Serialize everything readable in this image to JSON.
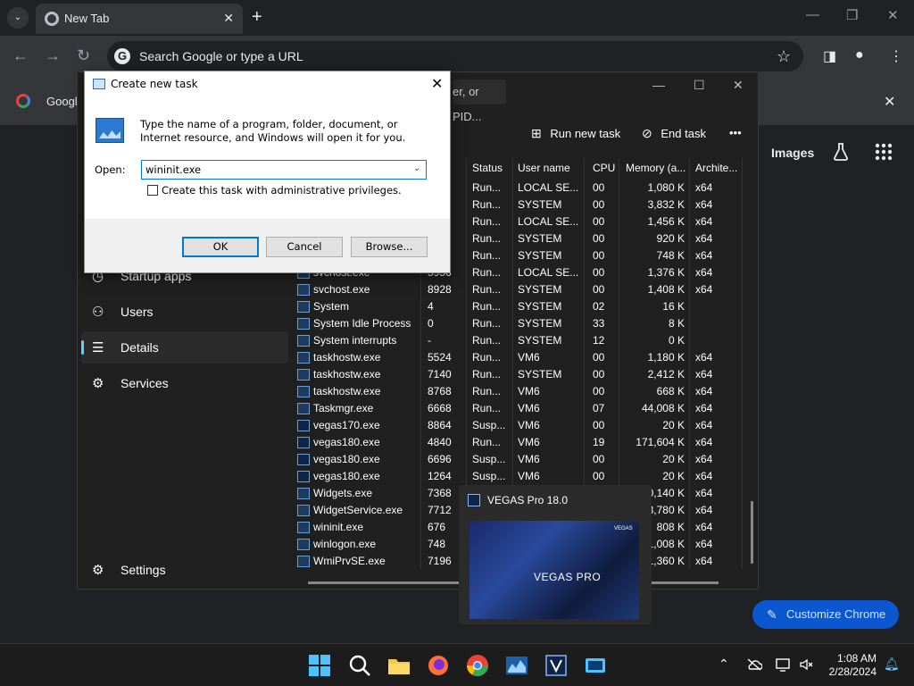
{
  "chrome": {
    "tab_title": "New Tab",
    "omnibox_placeholder": "Search Google or type a URL",
    "bookmark_label": "Googl",
    "images_link": "Images",
    "customize_label": "Customize Chrome"
  },
  "taskmgr": {
    "search_placeholder": "er, or PID...",
    "run_new_task": "Run new task",
    "end_task": "End task",
    "more": "•••",
    "sidebar": [
      {
        "label": "Startup apps",
        "icon": "startup-icon"
      },
      {
        "label": "Users",
        "icon": "users-icon"
      },
      {
        "label": "Details",
        "icon": "details-icon",
        "active": true
      },
      {
        "label": "Services",
        "icon": "services-icon"
      }
    ],
    "settings_label": "Settings",
    "columns": {
      "status": "Status",
      "user": "User name",
      "cpu": "CPU",
      "memory": "Memory (a...",
      "arch": "Archite..."
    },
    "rows": [
      {
        "name": "",
        "pid": "",
        "status": "Run...",
        "user": "LOCAL SE...",
        "cpu": "00",
        "mem": "1,080 K",
        "arch": "x64"
      },
      {
        "name": "",
        "pid": "",
        "status": "Run...",
        "user": "SYSTEM",
        "cpu": "00",
        "mem": "3,832 K",
        "arch": "x64"
      },
      {
        "name": "",
        "pid": "",
        "status": "Run...",
        "user": "LOCAL SE...",
        "cpu": "00",
        "mem": "1,456 K",
        "arch": "x64"
      },
      {
        "name": "",
        "pid": "",
        "status": "Run...",
        "user": "SYSTEM",
        "cpu": "00",
        "mem": "920 K",
        "arch": "x64"
      },
      {
        "name": "",
        "pid": "",
        "status": "Run...",
        "user": "SYSTEM",
        "cpu": "00",
        "mem": "748 K",
        "arch": "x64"
      },
      {
        "name": "svchost.exe",
        "pid": "5956",
        "status": "Run...",
        "user": "LOCAL SE...",
        "cpu": "00",
        "mem": "1,376 K",
        "arch": "x64"
      },
      {
        "name": "svchost.exe",
        "pid": "8928",
        "status": "Run...",
        "user": "SYSTEM",
        "cpu": "00",
        "mem": "1,408 K",
        "arch": "x64"
      },
      {
        "name": "System",
        "pid": "4",
        "status": "Run...",
        "user": "SYSTEM",
        "cpu": "02",
        "mem": "16 K",
        "arch": ""
      },
      {
        "name": "System Idle Process",
        "pid": "0",
        "status": "Run...",
        "user": "SYSTEM",
        "cpu": "33",
        "mem": "8 K",
        "arch": ""
      },
      {
        "name": "System interrupts",
        "pid": "-",
        "status": "Run...",
        "user": "SYSTEM",
        "cpu": "12",
        "mem": "0 K",
        "arch": ""
      },
      {
        "name": "taskhostw.exe",
        "pid": "5524",
        "status": "Run...",
        "user": "VM6",
        "cpu": "00",
        "mem": "1,180 K",
        "arch": "x64"
      },
      {
        "name": "taskhostw.exe",
        "pid": "7140",
        "status": "Run...",
        "user": "SYSTEM",
        "cpu": "00",
        "mem": "2,412 K",
        "arch": "x64"
      },
      {
        "name": "taskhostw.exe",
        "pid": "8768",
        "status": "Run...",
        "user": "VM6",
        "cpu": "00",
        "mem": "668 K",
        "arch": "x64"
      },
      {
        "name": "Taskmgr.exe",
        "pid": "6668",
        "status": "Run...",
        "user": "VM6",
        "cpu": "07",
        "mem": "44,008 K",
        "arch": "x64"
      },
      {
        "name": "vegas170.exe",
        "pid": "8864",
        "status": "Susp...",
        "user": "VM6",
        "cpu": "00",
        "mem": "20 K",
        "arch": "x64"
      },
      {
        "name": "vegas180.exe",
        "pid": "4840",
        "status": "Run...",
        "user": "VM6",
        "cpu": "19",
        "mem": "171,604 K",
        "arch": "x64"
      },
      {
        "name": "vegas180.exe",
        "pid": "6696",
        "status": "Susp...",
        "user": "VM6",
        "cpu": "00",
        "mem": "20 K",
        "arch": "x64"
      },
      {
        "name": "vegas180.exe",
        "pid": "1264",
        "status": "Susp...",
        "user": "VM6",
        "cpu": "00",
        "mem": "20 K",
        "arch": "x64"
      },
      {
        "name": "Widgets.exe",
        "pid": "7368",
        "status": "",
        "user": "",
        "cpu": "",
        "mem": "0,140 K",
        "arch": "x64"
      },
      {
        "name": "WidgetService.exe",
        "pid": "7712",
        "status": "",
        "user": "",
        "cpu": "",
        "mem": "3,780 K",
        "arch": "x64"
      },
      {
        "name": "wininit.exe",
        "pid": "676",
        "status": "",
        "user": "",
        "cpu": "",
        "mem": "808 K",
        "arch": "x64"
      },
      {
        "name": "winlogon.exe",
        "pid": "748",
        "status": "",
        "user": "",
        "cpu": "",
        "mem": "1,008 K",
        "arch": "x64"
      },
      {
        "name": "WmiPrvSE.exe",
        "pid": "7196",
        "status": "",
        "user": "",
        "cpu": "",
        "mem": "1,360 K",
        "arch": "x64"
      }
    ]
  },
  "run_dialog": {
    "title": "Create new task",
    "description": "Type the name of a program, folder, document, or Internet resource, and Windows will open it for you.",
    "open_label": "Open:",
    "input_value": "wininit.exe",
    "admin_checkbox_label": "Create this task with administrative privileges.",
    "ok": "OK",
    "cancel": "Cancel",
    "browse": "Browse..."
  },
  "vegas_preview": {
    "title": "VEGAS Pro 18.0",
    "splash_name": "VEGAS PRO",
    "splash_logo": "VEGAS"
  },
  "taskbar": {
    "time": "1:08 AM",
    "date": "2/28/2024"
  }
}
